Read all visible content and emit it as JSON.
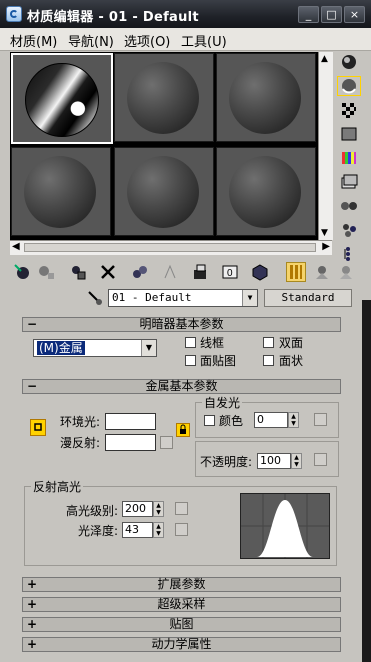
{
  "window": {
    "title": "材质编辑器 - 01 - Default",
    "buttons": {
      "minimize": "_",
      "maximize": "□",
      "close": "×"
    }
  },
  "menubar": {
    "items": [
      "材质(M)",
      "导航(N)",
      "选项(O)",
      "工具(U)"
    ]
  },
  "sample_slots": {
    "count": 6,
    "active_index": 0,
    "active_type": "metal"
  },
  "side_tools": [
    "sample-type-icon",
    "backlight-icon",
    "background-icon",
    "sample-uv-tiling-icon",
    "video-color-check-icon",
    "make-preview-icon",
    "options-icon",
    "select-by-material-icon",
    "material-map-navigator-icon"
  ],
  "bottom_tools": [
    "get-material-icon",
    "put-to-scene-icon",
    "assign-to-selection-icon",
    "reset-map-icon",
    "make-unique-icon",
    "put-to-library-icon",
    "material-id-icon",
    "show-map-in-viewport-icon",
    "show-end-result-icon",
    "go-to-parent-icon",
    "go-forward-to-sibling-icon"
  ],
  "material": {
    "name": "01 - Default",
    "type_button": "Standard"
  },
  "shader_basic": {
    "title": "明暗器基本参数",
    "shader": "(M)金属",
    "wire_label": "线框",
    "two_sided_label": "双面",
    "face_map_label": "面贴图",
    "faceted_label": "面状"
  },
  "metal_basic": {
    "title": "金属基本参数",
    "ambient_label": "环境光:",
    "diffuse_label": "漫反射:",
    "self_illum_title": "自发光",
    "color_label": "颜色",
    "self_illum_value": "0",
    "opacity_label": "不透明度:",
    "opacity_value": "100",
    "specular_title": "反射高光",
    "specular_level_label": "高光级别:",
    "specular_level_value": "200",
    "glossiness_label": "光泽度:",
    "glossiness_value": "43"
  },
  "collapsed_rollouts": [
    "扩展参数",
    "超级采样",
    "贴图",
    "动力学属性"
  ],
  "colors": {
    "accent": "#ffd200",
    "titlebar": "#1f2228"
  }
}
